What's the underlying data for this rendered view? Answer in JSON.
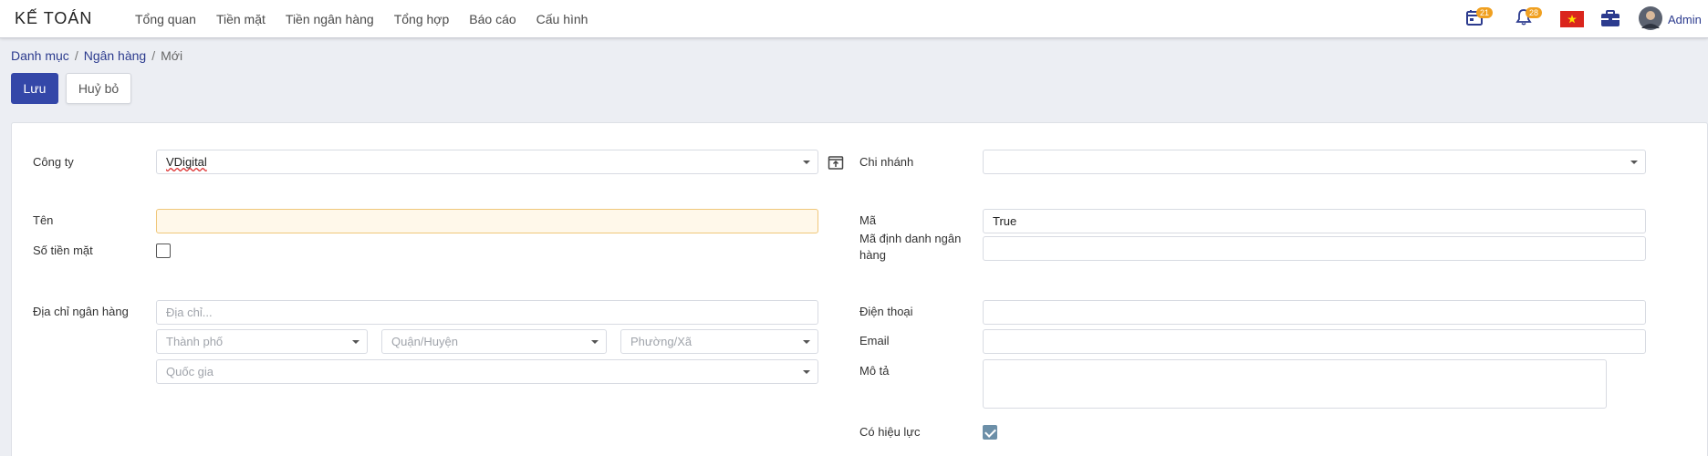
{
  "app": {
    "title": "KẾ TOÁN"
  },
  "menu": [
    "Tổng quan",
    "Tiền mặt",
    "Tiền ngân hàng",
    "Tổng hợp",
    "Báo cáo",
    "Cấu hình"
  ],
  "header": {
    "calendar_badge": "21",
    "notification_badge": "28",
    "user_name": "Admin"
  },
  "breadcrumb": {
    "item1": "Danh mục",
    "item2": "Ngân hàng",
    "current": "Mới",
    "separator": "/"
  },
  "actions": {
    "save_label": "Lưu",
    "cancel_label": "Huỷ bỏ"
  },
  "form": {
    "company": {
      "label": "Công ty",
      "value": "VDigital"
    },
    "branch": {
      "label": "Chi nhánh",
      "value": ""
    },
    "name": {
      "label": "Tên",
      "value": ""
    },
    "code": {
      "label": "Mã",
      "value": "True"
    },
    "cash_book": {
      "label": "Số tiền mặt",
      "checked": false
    },
    "bank_identifier": {
      "label": "Mã định danh ngân hàng",
      "value": ""
    },
    "bank_address": {
      "label": "Địa chỉ ngân hàng",
      "address_placeholder": "Địa chỉ...",
      "city_placeholder": "Thành phố",
      "district_placeholder": "Quận/Huyện",
      "ward_placeholder": "Phường/Xã",
      "country_placeholder": "Quốc gia"
    },
    "phone": {
      "label": "Điện thoại",
      "value": ""
    },
    "email": {
      "label": "Email",
      "value": ""
    },
    "description": {
      "label": "Mô tả",
      "value": ""
    },
    "active": {
      "label": "Có hiệu lực",
      "checked": true
    }
  },
  "colors": {
    "primary": "#3447a8",
    "link": "#2c3b8e",
    "badge": "#f0a020"
  }
}
